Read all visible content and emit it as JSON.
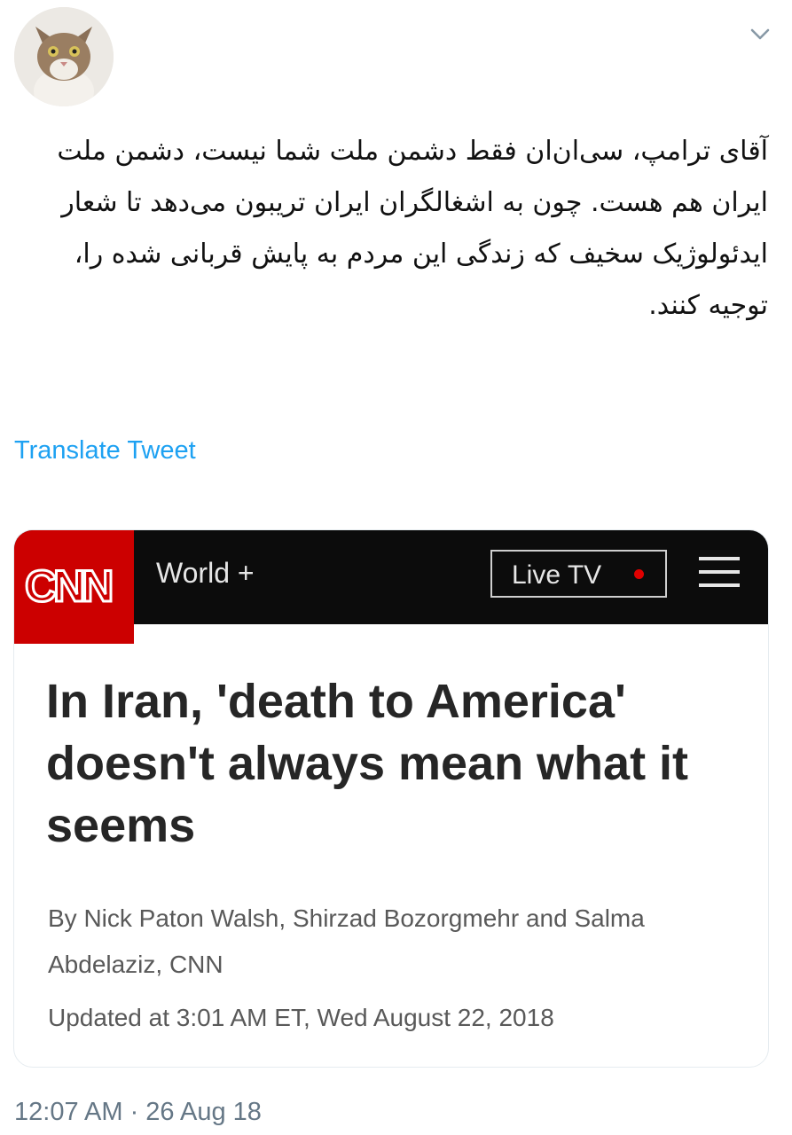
{
  "tweet": {
    "text": "آقای ترامپ، سی‌ان‌ان فقط دشمن ملت شما نیست، دشمن ملت ایران هم هست. چون به اشغالگران ایران تریبون می‌دهد تا شعار ایدئولوژیک سخیف که زندگی این مردم به پایش قربانی شده را، توجیه کنند.",
    "translate_label": "Translate Tweet",
    "timestamp": "12:07 AM · 26 Aug 18"
  },
  "card": {
    "brand": "CNN",
    "section_label": "World +",
    "live_tv_label": "Live TV",
    "headline": "In Iran, 'death to America' doesn't always mean what it seems",
    "byline": "By Nick Paton Walsh, Shirzad Bozorgmehr and Salma Abdelaziz, CNN",
    "updated": "Updated at 3:01 AM ET, Wed August 22, 2018"
  },
  "icons": {
    "avatar": "cat-avatar-icon",
    "menu_caret": "chevron-down-icon",
    "nav_menu": "hamburger-menu-icon",
    "live_indicator": "live-dot-icon"
  },
  "colors": {
    "link": "#1da1f2",
    "cnn_red": "#cc0000",
    "cnn_bar": "#0c0c0c",
    "live_dot": "#e00000",
    "meta_gray": "#657786"
  }
}
